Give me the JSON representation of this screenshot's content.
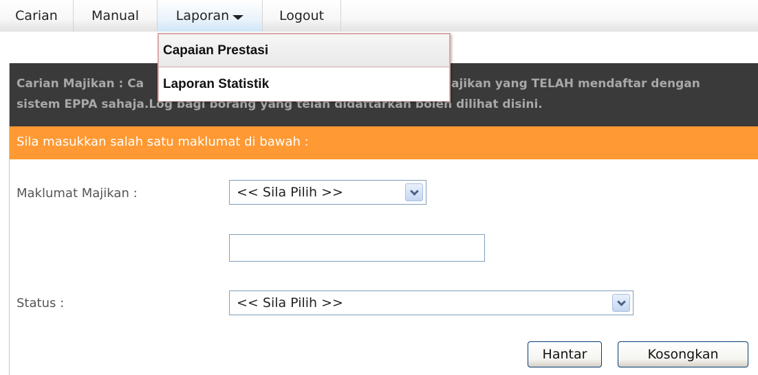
{
  "nav": {
    "items": [
      {
        "label": "Carian"
      },
      {
        "label": "Manual"
      },
      {
        "label": "Laporan"
      },
      {
        "label": "Logout"
      }
    ]
  },
  "dropdown": {
    "items": [
      {
        "label": "Capaian Prestasi"
      },
      {
        "label": "Laporan Statistik"
      }
    ]
  },
  "header": {
    "line1_left": "Carian Majikan : Ca",
    "line1_right": "ajikan yang TELAH mendaftar dengan",
    "line2": "sistem EPPA sahaja.Log bagi borang yang telah didaftarkan boleh dilihat disini."
  },
  "instruction": "Sila masukkan salah satu maklumat di bawah :",
  "form": {
    "majikan_label": "Maklumat Majikan :",
    "majikan_select": "<< Sila Pilih >>",
    "majikan_input": "",
    "status_label": "Status :",
    "status_select": "<< Sila Pilih >>"
  },
  "buttons": {
    "submit": "Hantar",
    "clear": "Kosongkan"
  },
  "colors": {
    "header_bg": "#3a3a3a",
    "orange": "#ff9933",
    "nav_active": "#cfe6f7"
  }
}
